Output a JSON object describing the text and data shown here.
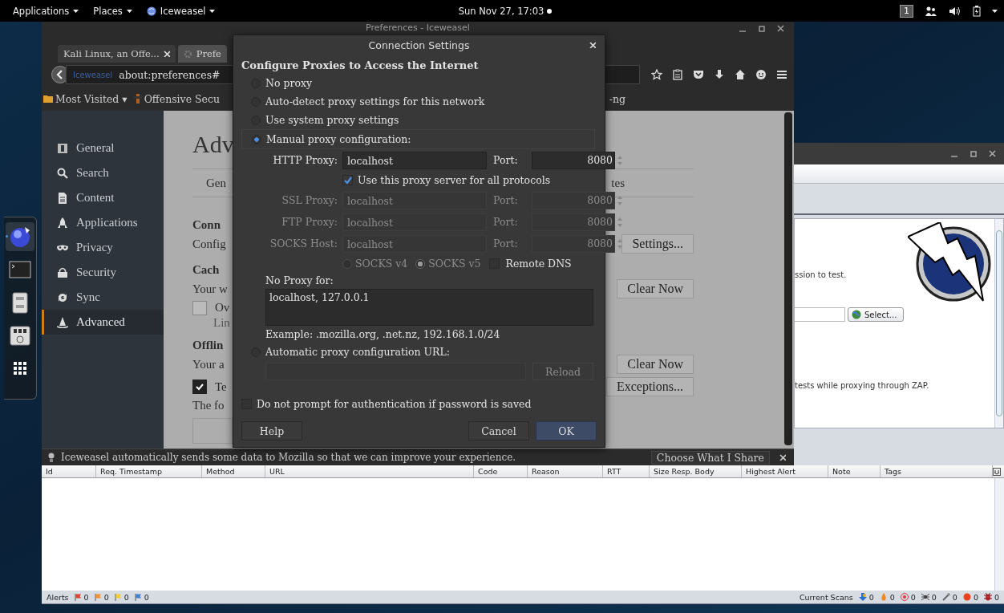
{
  "top_bar": {
    "menus": [
      {
        "label": "Applications",
        "kind": "plain"
      },
      {
        "label": "Places",
        "kind": "plain"
      },
      {
        "label": "Iceweasel",
        "kind": "app"
      }
    ],
    "clock": "Sun Nov 27, 17:03",
    "workspace": "1"
  },
  "dock": {
    "items": [
      {
        "kind": "browser",
        "selected": true
      },
      {
        "kind": "terminal",
        "selected": false
      },
      {
        "kind": "files",
        "selected": false
      },
      {
        "kind": "mixer",
        "selected": false
      },
      {
        "kind": "apps",
        "selected": false
      }
    ]
  },
  "zap": {
    "lines": [
      "ssion to test.",
      "tests while proxying through ZAP."
    ],
    "select_button": "Select...",
    "table": {
      "columns": [
        "Id",
        "Req. Timestamp",
        "Method",
        "URL",
        "Code",
        "Reason",
        "RTT",
        "Size Resp. Body",
        "Highest Alert",
        "Note",
        "Tags"
      ]
    },
    "status_bar": {
      "alerts_label": "Alerts",
      "alerts": [
        {
          "count": "0",
          "color": "#e2412c"
        },
        {
          "count": "0",
          "color": "#f0932a"
        },
        {
          "count": "0",
          "color": "#f2cc2e"
        },
        {
          "count": "0",
          "color": "#3f7fd6"
        }
      ],
      "scans_label": "Current Scans",
      "scans": [
        {
          "kind": "arrow",
          "count": "0"
        },
        {
          "kind": "flame",
          "count": "0"
        },
        {
          "kind": "target",
          "count": "0"
        },
        {
          "kind": "spider",
          "count": "0"
        },
        {
          "kind": "wand",
          "count": "0"
        },
        {
          "kind": "ball",
          "count": "0"
        },
        {
          "kind": "bug",
          "count": "0"
        }
      ]
    }
  },
  "browser": {
    "title": "Preferences - Iceweasel",
    "tabs": [
      {
        "label": "Kali Linux, an Offe...",
        "selected": false,
        "closable": true
      },
      {
        "label": "Prefe",
        "selected": true,
        "closable": false
      }
    ],
    "identity": "Iceweasel",
    "url": "about:preferences#",
    "bookmarks": [
      {
        "label": "Most Visited ▾",
        "kind": "folder"
      },
      {
        "label": "Offensive Secu",
        "kind": "site"
      },
      {
        "label": "-ng",
        "kind": "plain"
      }
    ],
    "categories": [
      {
        "label": "General",
        "kind": "general",
        "selected": false
      },
      {
        "label": "Search",
        "kind": "search",
        "selected": false
      },
      {
        "label": "Content",
        "kind": "content",
        "selected": false
      },
      {
        "label": "Applications",
        "kind": "applications",
        "selected": false
      },
      {
        "label": "Privacy",
        "kind": "privacy",
        "selected": false
      },
      {
        "label": "Security",
        "kind": "security",
        "selected": false
      },
      {
        "label": "Sync",
        "kind": "sync",
        "selected": false
      },
      {
        "label": "Advanced",
        "kind": "advanced",
        "selected": true
      }
    ],
    "page": {
      "heading": "Adv",
      "subtabs": [
        "Gen",
        "tes"
      ],
      "rows": [
        {
          "kind": "section",
          "text": "Conn"
        },
        {
          "kind": "text",
          "text": "Config",
          "button": "Settings..."
        },
        {
          "kind": "section",
          "text": "Cach"
        },
        {
          "kind": "text",
          "text": "Your w",
          "button": "Clear Now"
        },
        {
          "kind": "checkbox",
          "text": "Ov",
          "checked": false
        },
        {
          "kind": "indent",
          "text": "Lin"
        },
        {
          "kind": "section",
          "text": "Offlin"
        },
        {
          "kind": "text",
          "text": "Your a",
          "button": "Clear Now"
        },
        {
          "kind": "checkbox",
          "text": "Te",
          "checked": true,
          "button": "Exceptions..."
        },
        {
          "kind": "text",
          "text": "The fo"
        }
      ]
    },
    "notification": {
      "text": "Iceweasel automatically sends some data to Mozilla so that we can improve your experience.",
      "button": "Choose What I Share"
    }
  },
  "dialog": {
    "title": "Connection Settings",
    "heading": "Configure Proxies to Access the Internet",
    "proxy_modes": [
      {
        "label": "No proxy",
        "selected": false
      },
      {
        "label": "Auto-detect proxy settings for this network",
        "selected": false
      },
      {
        "label": "Use system proxy settings",
        "selected": false
      },
      {
        "label": "Manual proxy configuration:",
        "selected": true
      }
    ],
    "proxies": [
      {
        "label": "HTTP Proxy:",
        "host": "localhost",
        "port_label": "Port:",
        "port": "8080",
        "disabled": false
      },
      {
        "label": "SSL Proxy:",
        "host": "localhost",
        "port_label": "Port:",
        "port": "8080",
        "disabled": true
      },
      {
        "label": "FTP Proxy:",
        "host": "localhost",
        "port_label": "Port:",
        "port": "8080",
        "disabled": true
      },
      {
        "label": "SOCKS Host:",
        "host": "localhost",
        "port_label": "Port:",
        "port": "8080",
        "disabled": true
      }
    ],
    "share_all": {
      "label": "Use this proxy server for all protocols",
      "checked": true
    },
    "socks_versions": [
      {
        "label": "SOCKS v4",
        "selected": false
      },
      {
        "label": "SOCKS v5",
        "selected": true
      }
    ],
    "remote_dns": {
      "label": "Remote DNS",
      "checked": false
    },
    "no_proxy_label": "No Proxy for:",
    "no_proxy_value": "localhost, 127.0.0.1",
    "example": "Example: .mozilla.org, .net.nz, 192.168.1.0/24",
    "auto_url": {
      "label": "Automatic proxy configuration URL:",
      "selected": false
    },
    "reload": "Reload",
    "no_prompt": {
      "label": "Do not prompt for authentication if password is saved",
      "checked": false
    },
    "buttons": [
      {
        "label": "Help",
        "kind": "normal"
      },
      {
        "label": "Cancel",
        "kind": "normal"
      },
      {
        "label": "OK",
        "kind": "default"
      }
    ]
  }
}
